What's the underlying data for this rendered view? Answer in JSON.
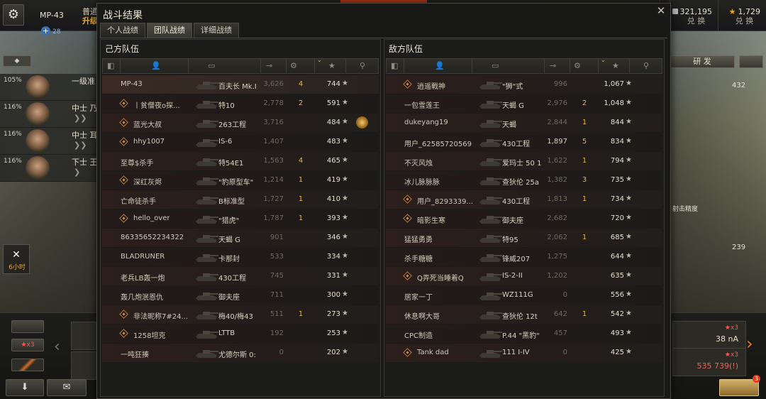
{
  "topbar": {
    "tank_name": "MP-43",
    "plus_xp": "28",
    "mode_line1": "普通",
    "mode_line2": "升级",
    "res1_value": "28",
    "res1_label": "",
    "silver_value": "321,195",
    "silver_label": "兑 换",
    "gold_value": "1,729",
    "gold_label": "兑 换"
  },
  "crew": [
    {
      "pct": "105%",
      "rank": "一级准"
    },
    {
      "pct": "116%",
      "rank": "中士 乃"
    },
    {
      "pct": "116%",
      "rank": "中士 耳"
    },
    {
      "pct": "116%",
      "rank": "下士 王"
    }
  ],
  "timer": {
    "label": "6小时"
  },
  "right": {
    "research": "研 发",
    "num1": "432",
    "num2": "239",
    "map_label": "射击精度",
    "slot1_badge": "★x3",
    "slot1_text": "38 nA",
    "slot2_badge": "★x3",
    "slot2_text": "535 739(!)",
    "notif_count": "3"
  },
  "carousel": {
    "left_badge": "★x3"
  },
  "dialog": {
    "title": "战斗结果",
    "tabs": [
      "个人战绩",
      "团队战绩",
      "详细战绩"
    ],
    "active_tab": 1
  },
  "teams": {
    "ally": {
      "title": "己方队伍",
      "players": [
        {
          "name": "MP-43",
          "vehicle": "百夫长 Mk.I",
          "damage": "3,626",
          "kills": "4",
          "xp": "744",
          "platoon": false,
          "self": true
        },
        {
          "name": "丨贫僧夜o探...",
          "vehicle": "特10",
          "damage": "2,778",
          "kills": "2",
          "xp": "591",
          "platoon": true
        },
        {
          "name": "蓝光大叔",
          "vehicle": "263工程",
          "damage": "3,716",
          "kills": "",
          "xp": "484",
          "platoon": true,
          "medal": true
        },
        {
          "name": "hhy1007",
          "vehicle": "IS-6",
          "damage": "1,407",
          "kills": "",
          "xp": "483",
          "platoon": true
        },
        {
          "name": "至尊$杀手",
          "vehicle": "特54E1",
          "damage": "1,563",
          "kills": "4",
          "xp": "465",
          "platoon": false
        },
        {
          "name": "深红灰烬",
          "vehicle": "\"豹原型车\"",
          "damage": "1,214",
          "kills": "1",
          "xp": "419",
          "platoon": true
        },
        {
          "name": "亡命徒杀手",
          "vehicle": "B标准型",
          "damage": "1,727",
          "kills": "1",
          "xp": "410",
          "platoon": false
        },
        {
          "name": "hello_over",
          "vehicle": "\"猎虎\"",
          "damage": "1,787",
          "kills": "1",
          "xp": "393",
          "platoon": true
        },
        {
          "name": "86335652234322",
          "vehicle": "天蝎 G",
          "damage": "901",
          "kills": "",
          "xp": "346",
          "platoon": false
        },
        {
          "name": "BLADRUNER",
          "vehicle": "卡那封",
          "damage": "533",
          "kills": "",
          "xp": "334",
          "platoon": false
        },
        {
          "name": "老兵LB轰一炮",
          "vehicle": "430工程",
          "damage": "745",
          "kills": "",
          "xp": "331",
          "platoon": false
        },
        {
          "name": "轰几炮泯恩仇",
          "vehicle": "御夫座",
          "damage": "711",
          "kills": "",
          "xp": "300",
          "platoon": false
        },
        {
          "name": "非法昵称7#24...",
          "vehicle": "梅40/梅43",
          "damage": "511",
          "kills": "1",
          "xp": "273",
          "platoon": true
        },
        {
          "name": "1258坦克",
          "vehicle": "LTTB",
          "damage": "192",
          "kills": "",
          "xp": "253",
          "platoon": true
        },
        {
          "name": "一吨狂揍",
          "vehicle": "尤德尔斯 0:",
          "damage": "0",
          "kills": "",
          "xp": "202",
          "platoon": false
        }
      ]
    },
    "enemy": {
      "title": "敌方队伍",
      "players": [
        {
          "name": "逍遥戰神",
          "vehicle": "\"狮\"式",
          "damage": "996",
          "kills": "",
          "xp": "1,067",
          "platoon": true
        },
        {
          "name": "一包雪莲王",
          "vehicle": "天蝎 G",
          "damage": "2,976",
          "kills": "2",
          "xp": "1,048",
          "platoon": false
        },
        {
          "name": "dukeyang19",
          "vehicle": "天蝎",
          "damage": "2,844",
          "kills": "1",
          "xp": "844",
          "platoon": false
        },
        {
          "name": "用户_62585720569",
          "vehicle": "430工程",
          "damage": "1,897",
          "kills": "5",
          "xp": "834",
          "platoon": false,
          "bright": true
        },
        {
          "name": "不灭风烛",
          "vehicle": "爱玛士 50 1",
          "damage": "1,622",
          "kills": "1",
          "xp": "794",
          "platoon": false
        },
        {
          "name": "冰儿脉脉脉",
          "vehicle": "查狄伦 25a",
          "damage": "1,382",
          "kills": "3",
          "xp": "735",
          "platoon": false
        },
        {
          "name": "用户_8293339...",
          "vehicle": "430工程",
          "damage": "1,813",
          "kills": "1",
          "xp": "734",
          "platoon": true
        },
        {
          "name": "暗影生寒",
          "vehicle": "御夫座",
          "damage": "2,682",
          "kills": "",
          "xp": "720",
          "platoon": true
        },
        {
          "name": "猛猛勇勇",
          "vehicle": "特95",
          "damage": "2,062",
          "kills": "1",
          "xp": "685",
          "platoon": false
        },
        {
          "name": "杀手糖糖",
          "vehicle": "锋威207",
          "damage": "1,275",
          "kills": "",
          "xp": "644",
          "platoon": false
        },
        {
          "name": "Q弄死当睡着Q",
          "vehicle": "IS-2-II",
          "damage": "1,202",
          "kills": "",
          "xp": "635",
          "platoon": true
        },
        {
          "name": "居家一丁",
          "vehicle": "WZ111G",
          "damage": "0",
          "kills": "",
          "xp": "556",
          "platoon": false
        },
        {
          "name": "休息啊大哥",
          "vehicle": "查狄伦 12t",
          "damage": "642",
          "kills": "1",
          "xp": "542",
          "platoon": false
        },
        {
          "name": "CPC制造",
          "vehicle": "P.44 \"黑豹\"",
          "damage": "457",
          "kills": "",
          "xp": "493",
          "platoon": false
        },
        {
          "name": "Tank dad",
          "vehicle": "111 I-IV",
          "damage": "0",
          "kills": "",
          "xp": "425",
          "platoon": true
        }
      ]
    }
  }
}
